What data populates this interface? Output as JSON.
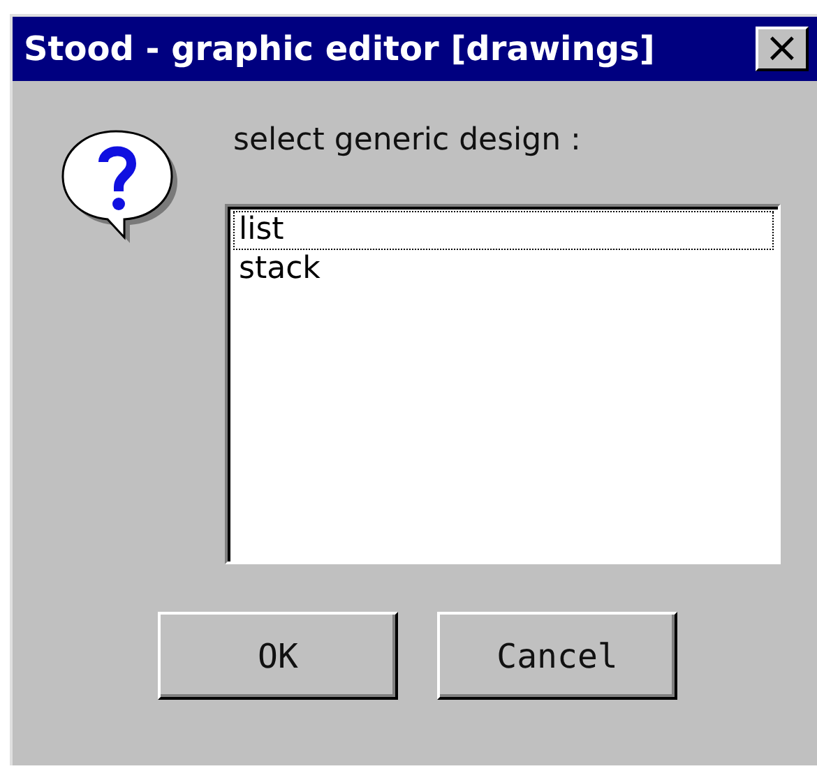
{
  "window": {
    "title": "Stood - graphic editor [drawings]",
    "close": "×"
  },
  "prompt": "select generic design :",
  "list": [
    {
      "label": "list",
      "focused": true
    },
    {
      "label": "stack",
      "focused": false
    }
  ],
  "buttons": [
    "OK",
    "Cancel"
  ]
}
